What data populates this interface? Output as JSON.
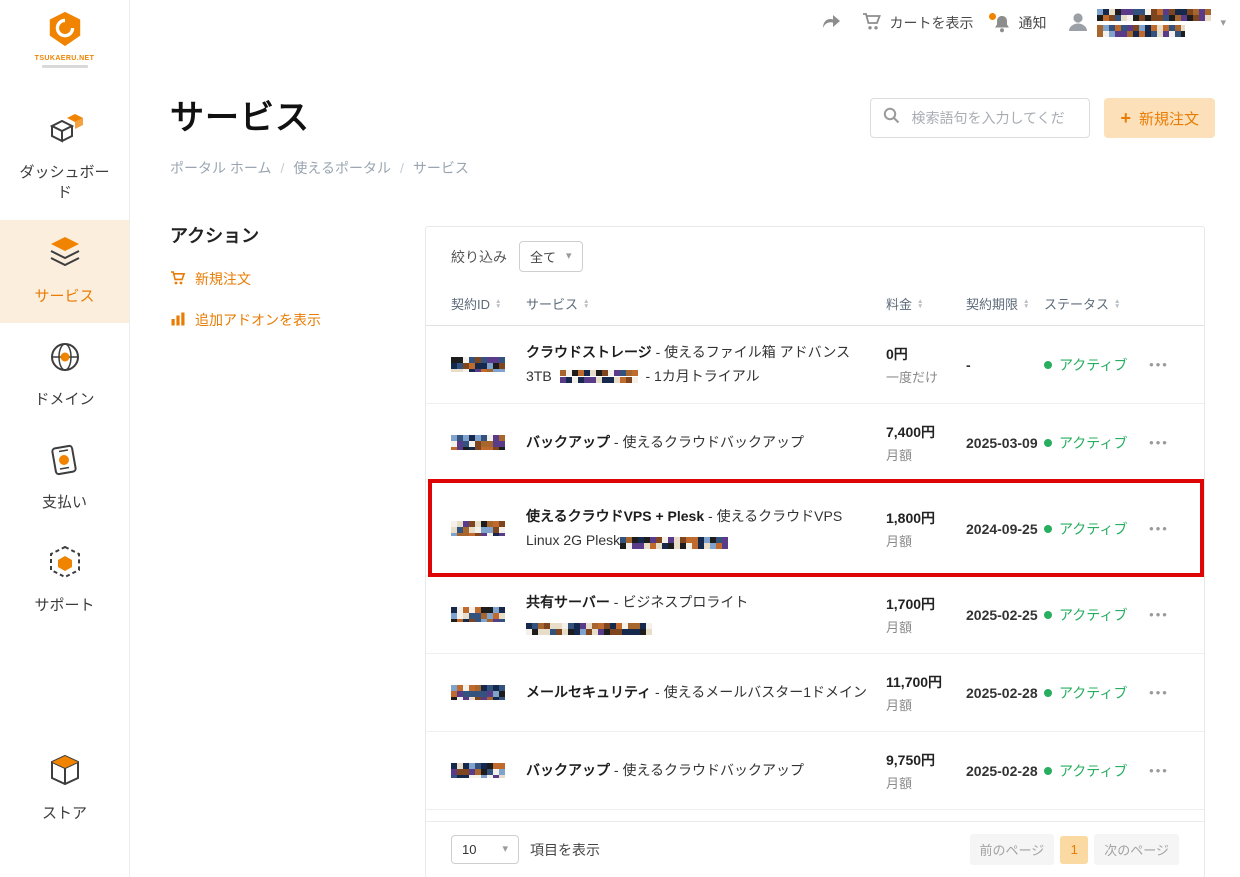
{
  "colors": {
    "accent": "#ee7c00",
    "status_active": "#27ae60",
    "annotation_red": "#dd0505"
  },
  "topbar": {
    "cart_label": "カートを表示",
    "notifications_label": "通知"
  },
  "sidebar": {
    "logo_text": "TSUKAERU.NET",
    "items": [
      {
        "label": "ダッシュボード",
        "active": false
      },
      {
        "label": "サービス",
        "active": true
      },
      {
        "label": "ドメイン",
        "active": false
      },
      {
        "label": "支払い",
        "active": false
      },
      {
        "label": "サポート",
        "active": false
      },
      {
        "label": "ストア",
        "active": false
      }
    ]
  },
  "header": {
    "title": "サービス",
    "search_placeholder": "検索語句を入力してくだ",
    "new_order_button": "新規注文"
  },
  "breadcrumb": {
    "items": [
      "ポータル ホーム",
      "使えるポータル",
      "サービス"
    ]
  },
  "actions": {
    "title": "アクション",
    "items": [
      "新規注文",
      "追加アドオンを表示"
    ]
  },
  "table": {
    "filter_label": "絞り込み",
    "filter_value": "全て",
    "columns": [
      "契約ID",
      "サービス",
      "料金",
      "契約期限",
      "ステータス"
    ],
    "rows": [
      {
        "service_bold": "クラウドストレージ",
        "service_rest": " - 使えるファイル箱 アドバンス3TB ",
        "service_rest2": " - 1カ月トライアル",
        "price": "0円",
        "price_period": "一度だけ",
        "expiry": "-",
        "status": "アクティブ"
      },
      {
        "service_bold": "バックアップ",
        "service_rest": " - 使えるクラウドバックアップ",
        "price": "7,400円",
        "price_period": "月額",
        "expiry": "2025-03-09",
        "status": "アクティブ"
      },
      {
        "service_bold": "使えるクラウドVPS + Plesk",
        "service_rest": " - 使えるクラウドVPS Linux 2G Plesk",
        "price": "1,800円",
        "price_period": "月額",
        "expiry": "2024-09-25",
        "status": "アクティブ",
        "highlighted": true
      },
      {
        "service_bold": "共有サーバー",
        "service_rest": " - ビジネスプロライト",
        "price": "1,700円",
        "price_period": "月額",
        "expiry": "2025-02-25",
        "status": "アクティブ"
      },
      {
        "service_bold": "メールセキュリティ",
        "service_rest": " - 使えるメールバスター1ドメイン",
        "price": "11,700円",
        "price_period": "月額",
        "expiry": "2025-02-28",
        "status": "アクティブ"
      },
      {
        "service_bold": "バックアップ",
        "service_rest": " - 使えるクラウドバックアップ",
        "price": "9,750円",
        "price_period": "月額",
        "expiry": "2025-02-28",
        "status": "アクティブ"
      }
    ],
    "footer": {
      "page_size": "10",
      "page_size_label": "項目を表示",
      "prev_label": "前のページ",
      "current_page": "1",
      "next_label": "次のページ"
    }
  }
}
